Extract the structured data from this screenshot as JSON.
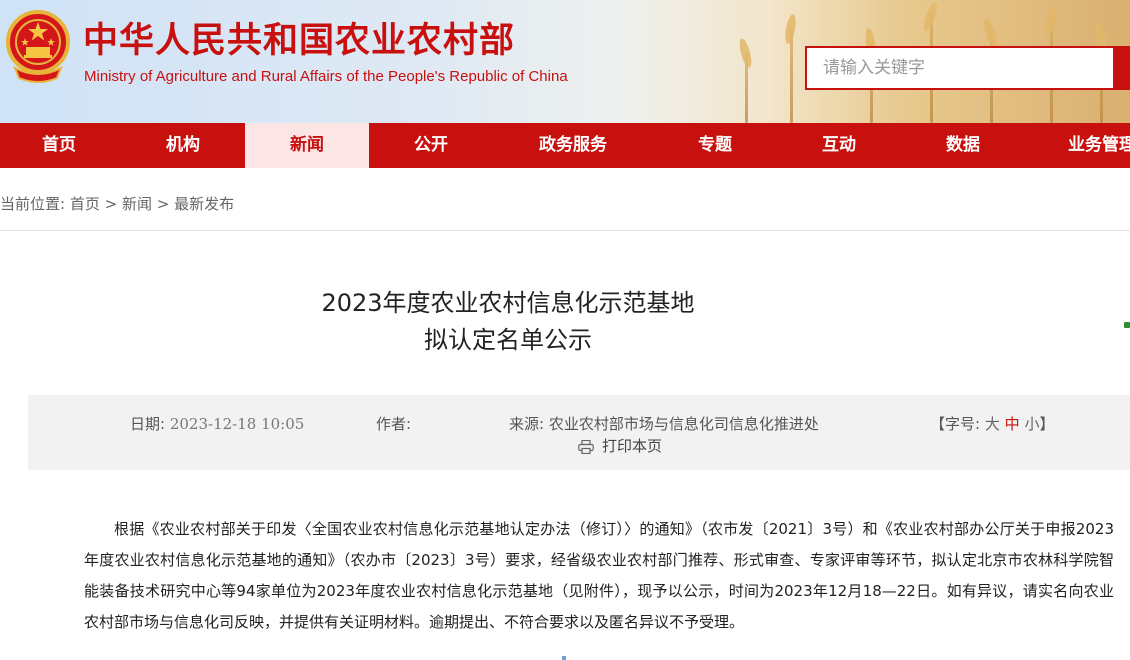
{
  "header": {
    "title": "中华人民共和国农业农村部",
    "subtitle": "Ministry of Agriculture and Rural Affairs of the People's Republic of China",
    "search_placeholder": "请输入关键字",
    "emblem_icon": "national-emblem-icon",
    "brand_color": "#c8100f"
  },
  "nav": {
    "items": [
      "首页",
      "机构",
      "新闻",
      "公开",
      "政务服务",
      "专题",
      "互动",
      "数据",
      "业务管理"
    ],
    "active": "新闻"
  },
  "breadcrumb": {
    "prefix": "当前位置:",
    "items": [
      "首页",
      "新闻",
      "最新发布"
    ],
    "separator": ">"
  },
  "article": {
    "title_line1": "2023年度农业农村信息化示范基地",
    "title_line2": "拟认定名单公示",
    "date_label": "日期:",
    "date_value": "2023-12-18 10:05",
    "author_label": "作者:",
    "source_label": "来源:",
    "source_value": "农业农村部市场与信息化司信息化推进处",
    "font_size_open": "【字号:",
    "font_size_big": "大",
    "font_size_mid": "中",
    "font_size_small": "小",
    "font_size_close": "】",
    "print_label": "打印本页",
    "print_icon": "printer-icon",
    "body": "根据《农业农村部关于印发〈全国农业农村信息化示范基地认定办法（修订）〉的通知》（农市发〔2021〕3号）和《农业农村部办公厅关于申报2023年度农业农村信息化示范基地的通知》（农办市〔2023〕3号）要求，经省级农业农村部门推荐、形式审查、专家评审等环节，拟认定北京市农林科学院智能装备技术研究中心等94家单位为2023年度农业农村信息化示范基地（见附件），现予以公示，时间为2023年12月18—22日。如有异议，请实名向农业农村部市场与信息化司反映，并提供有关证明材料。逾期提出、不符合要求以及匿名异议不予受理。"
  }
}
